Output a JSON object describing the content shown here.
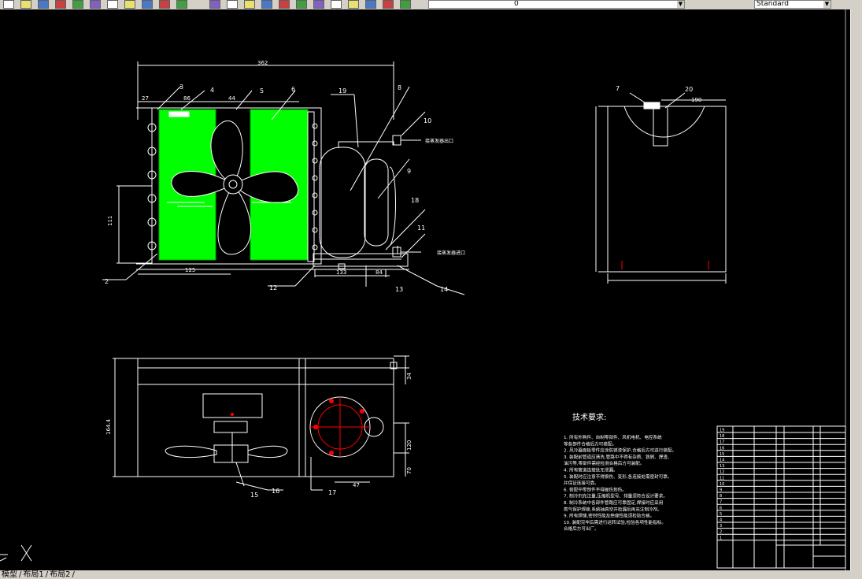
{
  "toolbar": {
    "icons": [
      "new-icon",
      "open-icon",
      "save-icon",
      "print-icon",
      "preview-icon",
      "cut-icon",
      "copy-icon",
      "paste-icon",
      "match-icon",
      "undo-icon",
      "redo-icon",
      "pan-icon",
      "zoom-realtime-icon",
      "zoom-window-icon",
      "zoom-previous-icon",
      "properties-icon",
      "design-center-icon",
      "tool-palettes-icon",
      "sheet-set-icon",
      "markup-icon",
      "calculator-icon",
      "help-icon",
      "layer-manager-icon"
    ],
    "layer_value": "0",
    "style_value": "Standard"
  },
  "tabs": [
    "模型",
    "布局1",
    "布局2"
  ],
  "drawing": {
    "dims": {
      "overall_width": "362",
      "d27": "27",
      "d86": "86",
      "d44": "44",
      "d111": "111",
      "d125": "125",
      "d190": "190",
      "d133": "133",
      "d84": "84",
      "d47": "47",
      "d34": "34",
      "d70": "70",
      "d164": "164.4",
      "d120": "120"
    },
    "balloons": [
      "2",
      "3",
      "4",
      "5",
      "6",
      "8",
      "9",
      "10",
      "11",
      "12",
      "13",
      "14",
      "15",
      "16",
      "17",
      "18",
      "19",
      "20",
      "7"
    ],
    "pipe_labels": {
      "top": "接蒸发器出口",
      "bottom": "接蒸发器进口"
    },
    "tech_title": "技术要求:",
    "tech_lines": [
      "1. 所有外购件、自制零部件、风机电机、电控系统",
      "   等各部件合格后方可装配。",
      "2. 风冷器面板零件应涂防锈漆保护,合格后方可进行装配。",
      "3. 装配前管道应清洗,管路中不得有杂质、铁屑、焊渣、",
      "   油污等,零部件需经检测合格后方可装配。",
      "4. 所有管道连接处无泄漏。",
      "5. 装配时应注意不得损伤、变形,各连接处需密封可靠。",
      "   并保证连接可靠。",
      "6. 装配中零部件不得碰伤划伤。",
      "7. 制冷剂充注量,压缩机型号、排量须符合设计要求。",
      "8. 制冷系统中各部件管路应可靠固定,焊接时应采用",
      "   氮气保护焊接,系统抽真空并检漏后再充注制冷剂。",
      "9. 所有焊缝,密封性能及绝缘性能须检验合格。",
      "10. 装配完毕后需进行运转试验,检验各项性能指标。",
      "    合格后方可出厂。"
    ],
    "title_block_rows": [
      "19",
      "18",
      "17",
      "16",
      "15",
      "14",
      "13",
      "12",
      "11",
      "10",
      "9",
      "8",
      "7",
      "6",
      "5",
      "4",
      "3",
      "2",
      "1"
    ]
  }
}
